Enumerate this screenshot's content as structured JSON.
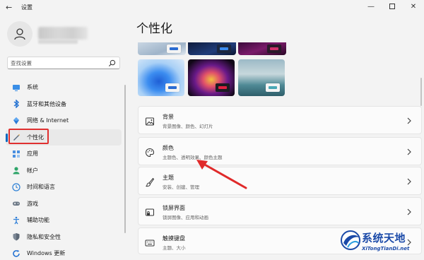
{
  "window": {
    "title": "设置",
    "back_glyph": "←",
    "minimize_glyph": "—",
    "close_glyph": "✕"
  },
  "search": {
    "placeholder": "查找设置"
  },
  "sidebar": {
    "items": [
      {
        "label": "系统",
        "icon": "monitor-icon",
        "active": false
      },
      {
        "label": "蓝牙和其他设备",
        "icon": "bluetooth-icon",
        "active": false
      },
      {
        "label": "网络 & Internet",
        "icon": "network-icon",
        "active": false
      },
      {
        "label": "个性化",
        "icon": "pen-icon",
        "active": true
      },
      {
        "label": "应用",
        "icon": "apps-icon",
        "active": false
      },
      {
        "label": "帐户",
        "icon": "account-icon",
        "active": false
      },
      {
        "label": "时间和语言",
        "icon": "globe-clock-icon",
        "active": false
      },
      {
        "label": "游戏",
        "icon": "gamepad-icon",
        "active": false
      },
      {
        "label": "辅助功能",
        "icon": "accessibility-icon",
        "active": false
      },
      {
        "label": "隐私和安全性",
        "icon": "shield-icon",
        "active": false
      },
      {
        "label": "Windows 更新",
        "icon": "update-icon",
        "active": false
      }
    ]
  },
  "main": {
    "title": "个性化",
    "settings": [
      {
        "title": "背景",
        "subtitle": "背景图像、颜色、幻灯片",
        "icon": "image-icon"
      },
      {
        "title": "颜色",
        "subtitle": "主题色、透明效果、颜色主题",
        "icon": "palette-icon"
      },
      {
        "title": "主题",
        "subtitle": "安装、创建、管理",
        "icon": "brush-icon"
      },
      {
        "title": "锁屏界面",
        "subtitle": "锁屏图像、应用和动画",
        "icon": "lock-screen-icon"
      },
      {
        "title": "触摸键盘",
        "subtitle": "主题、大小",
        "icon": "keyboard-icon"
      }
    ]
  },
  "watermark": {
    "name": "系统天地",
    "url": "XiTongTianDi.net"
  },
  "colors": {
    "accent": "#0067c0",
    "highlight_red": "#e03030"
  }
}
